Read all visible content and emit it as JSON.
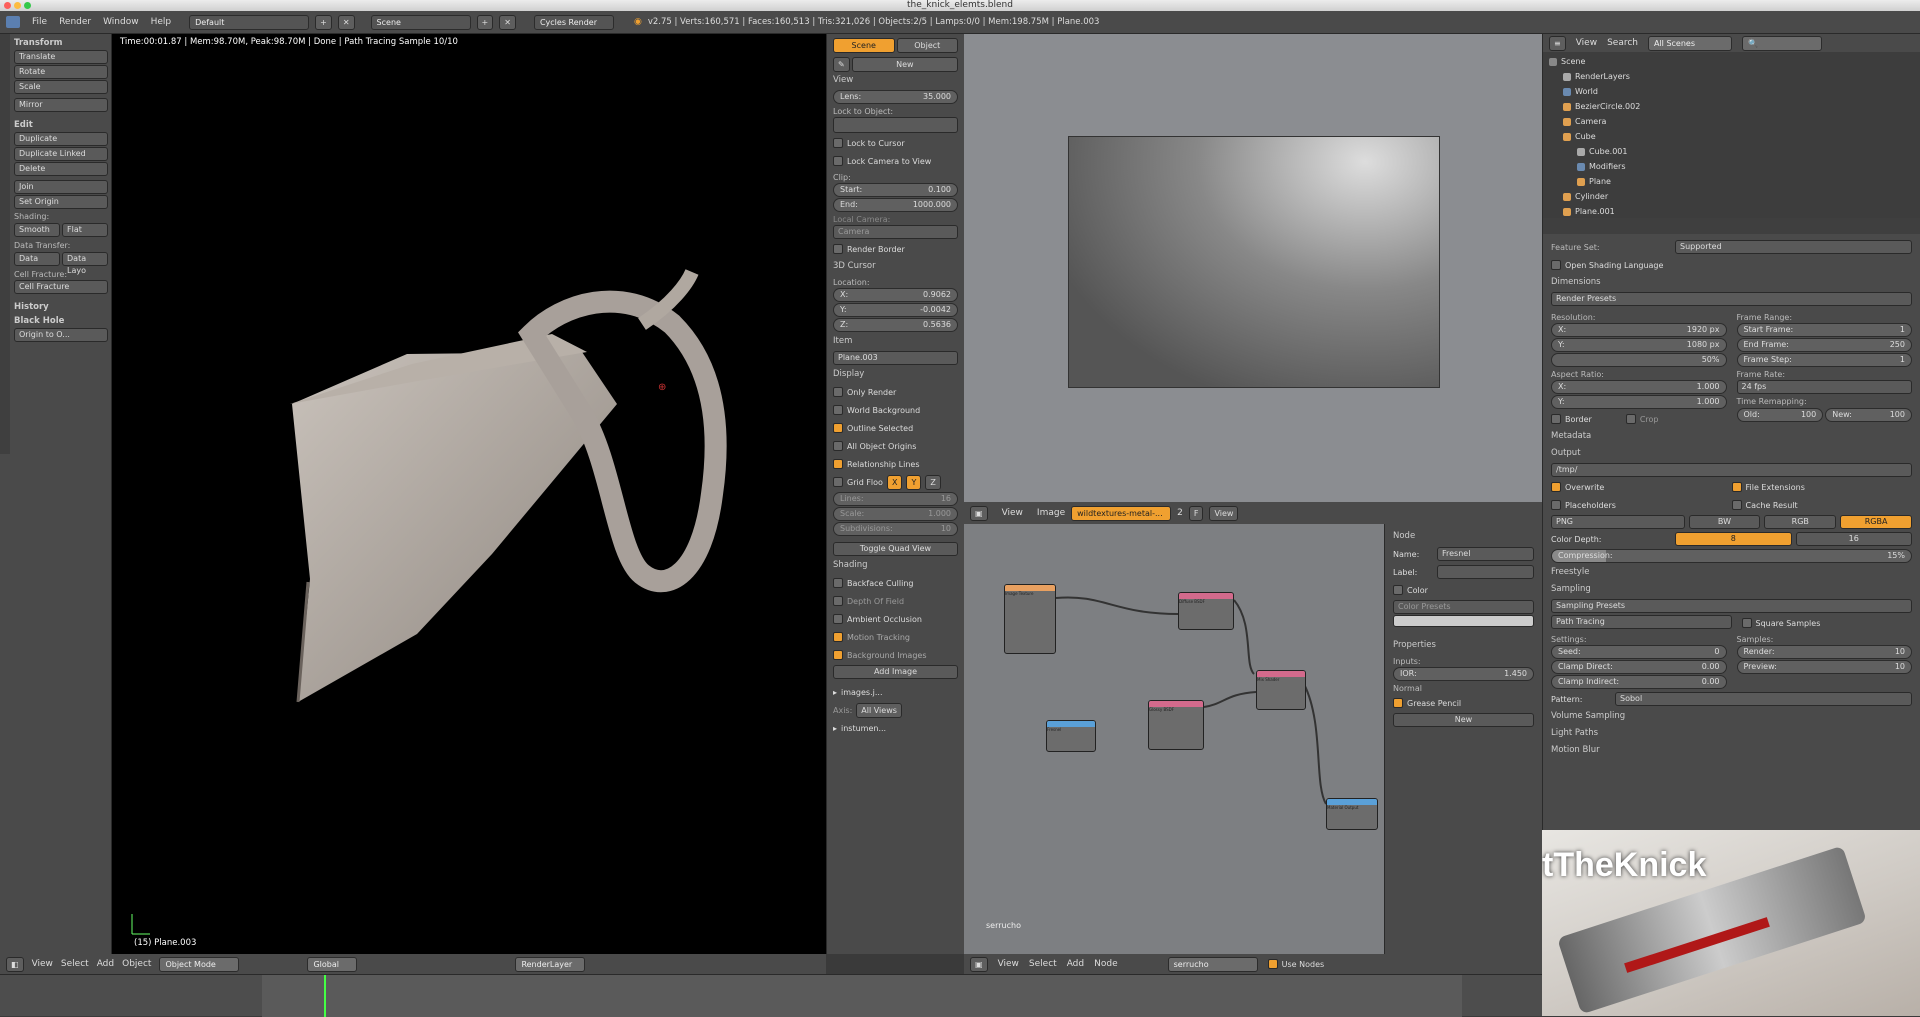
{
  "window": {
    "title": "the_knick_elemts.blend"
  },
  "topbar": {
    "menus": [
      "File",
      "Render",
      "Window",
      "Help"
    ],
    "layout": "Default",
    "scene": "Scene",
    "engine": "Cycles Render",
    "stats": "v2.75 | Verts:160,571 | Faces:160,513 | Tris:321,026 | Objects:2/5 | Lamps:0/0 | Mem:198.75M | Plane.003"
  },
  "toolshelf": {
    "transform_header": "Transform",
    "translate": "Translate",
    "rotate": "Rotate",
    "scale": "Scale",
    "mirror": "Mirror",
    "edit_header": "Edit",
    "duplicate": "Duplicate",
    "duplicate_linked": "Duplicate Linked",
    "delete": "Delete",
    "join": "Join",
    "set_origin": "Set Origin",
    "shading_label": "Shading:",
    "smooth": "Smooth",
    "flat": "Flat",
    "data_transfer_label": "Data Transfer:",
    "data": "Data",
    "data_layo": "Data Layo",
    "cell_fracture_label": "Cell Fracture:",
    "cell_fracture": "Cell Fracture",
    "history": "History",
    "black_hole": "Black Hole",
    "origin_to": "Origin to O..."
  },
  "viewport": {
    "info": "Time:00:01.87 | Mem:98.70M, Peak:98.70M | Done | Path Tracing Sample 10/10",
    "object_label": "(15) Plane.003"
  },
  "props": {
    "tab_scene": "Scene",
    "tab_object": "Object",
    "new": "New",
    "view_header": "View",
    "lens_label": "Lens:",
    "lens_value": "35.000",
    "lock_to_object": "Lock to Object:",
    "lock_to_cursor": "Lock to Cursor",
    "lock_camera": "Lock Camera to View",
    "clip_label": "Clip:",
    "start_label": "Start:",
    "start_value": "0.100",
    "end_label": "End:",
    "end_value": "1000.000",
    "local_camera": "Local Camera:",
    "camera": "Camera",
    "render_border": "Render Border",
    "cursor_header": "3D Cursor",
    "location": "Location:",
    "x_label": "X:",
    "x_value": "0.9062",
    "y_label": "Y:",
    "y_value": "-0.0042",
    "z_label": "Z:",
    "z_value": "0.5636",
    "item_header": "Item",
    "item_name": "Plane.003",
    "display_header": "Display",
    "only_render": "Only Render",
    "world_bg": "World Background",
    "outline_sel": "Outline Selected",
    "all_origins": "All Object Origins",
    "rel_lines": "Relationship Lines",
    "grid_floor": "Grid Floo",
    "gx": "X",
    "gy": "Y",
    "gz": "Z",
    "lines_label": "Lines:",
    "lines_value": "16",
    "scale_label": "Scale:",
    "scale_value": "1.000",
    "subdiv_label": "Subdivisions:",
    "subdiv_value": "10",
    "toggle_quad": "Toggle Quad View",
    "shading_header": "Shading",
    "backface": "Backface Culling",
    "dof": "Depth Of Field",
    "ao": "Ambient Occlusion",
    "motion_tracking": "Motion Tracking",
    "bg_images": "Background Images",
    "add_image": "Add Image",
    "img1": "images.j...",
    "axis_label": "Axis:",
    "all_views": "All Views",
    "img2": "instumen..."
  },
  "image_editor": {
    "menus": [
      "View",
      "Image"
    ],
    "image_name": "wildtextures-metal-...",
    "users": "2",
    "f": "F",
    "view": "View"
  },
  "node_editor": {
    "label": "serrucho",
    "header_menus": [
      "View",
      "Select",
      "Add",
      "Node"
    ],
    "material": "serrucho",
    "use_nodes": "Use Nodes",
    "nodes": {
      "image_texture": "Image Texture",
      "diffuse": "Diffuse BSDF",
      "glossy": "Glossy BSDF",
      "mix": "Mix Shader",
      "fresnel": "Fresnel",
      "output": "Material Output"
    }
  },
  "node_sidebar": {
    "node_header": "Node",
    "name_label": "Name:",
    "name_value": "Fresnel",
    "label_label": "Label:",
    "color_header": "Color",
    "color_presets": "Color Presets",
    "properties_header": "Properties",
    "inputs": "Inputs:",
    "ior_label": "IOR:",
    "ior_value": "1.450",
    "normal": "Normal",
    "grease_pencil": "Grease Pencil",
    "new": "New"
  },
  "outliner": {
    "menus": [
      "View",
      "Search"
    ],
    "filter": "All Scenes",
    "items": [
      "Scene",
      "RenderLayers",
      "World",
      "BezierCircle.002",
      "Camera",
      "Cube",
      "Cube.001",
      "Modifiers",
      "Plane",
      "Cylinder",
      "Plane.001"
    ]
  },
  "render_props": {
    "feature_set_label": "Feature Set:",
    "feature_set": "Supported",
    "osl": "Open Shading Language",
    "dimensions": "Dimensions",
    "render_presets": "Render Presets",
    "resolution": "Resolution:",
    "res_x_label": "X:",
    "res_x": "1920 px",
    "res_y_label": "Y:",
    "res_y": "1080 px",
    "res_pct": "50%",
    "frame_range": "Frame Range:",
    "start_frame_label": "Start Frame:",
    "start_frame": "1",
    "end_frame_label": "End Frame:",
    "end_frame": "250",
    "frame_step_label": "Frame Step:",
    "frame_step": "1",
    "aspect": "Aspect Ratio:",
    "asp_x_label": "X:",
    "asp_x": "1.000",
    "asp_y_label": "Y:",
    "asp_y": "1.000",
    "frame_rate": "Frame Rate:",
    "fps": "24 fps",
    "time_remap": "Time Remapping:",
    "old_label": "Old:",
    "old": "100",
    "new_label": "New:",
    "new": "100",
    "border": "Border",
    "crop": "Crop",
    "metadata": "Metadata",
    "output": "Output",
    "path": "/tmp/",
    "overwrite": "Overwrite",
    "file_ext": "File Extensions",
    "placeholders": "Placeholders",
    "cache_result": "Cache Result",
    "format": "PNG",
    "bw": "BW",
    "rgb": "RGB",
    "rgba": "RGBA",
    "color_depth": "Color Depth:",
    "depth8": "8",
    "depth16": "16",
    "compression_label": "Compression:",
    "compression": "15%",
    "freestyle": "Freestyle",
    "sampling": "Sampling",
    "sampling_presets": "Sampling Presets",
    "path_tracing": "Path Tracing",
    "square_samples": "Square Samples",
    "settings": "Settings:",
    "samples": "Samples:",
    "seed_label": "Seed:",
    "seed": "0",
    "render_label": "Render:",
    "render": "10",
    "clamp_direct_label": "Clamp Direct:",
    "clamp_direct": "0.00",
    "preview_label": "Preview:",
    "preview": "10",
    "clamp_indirect_label": "Clamp Indirect:",
    "clamp_indirect": "0.00",
    "pattern_label": "Pattern:",
    "pattern": "Sobol",
    "volume_sampling": "Volume Sampling",
    "light_paths": "Light Paths",
    "motion_blur": "Motion Blur"
  },
  "poster": {
    "text": "tTheKnick"
  },
  "bottombar": {
    "menus": [
      "View",
      "Select",
      "Add",
      "Object"
    ],
    "mode": "Object Mode",
    "orientation": "Global",
    "render_layer": "RenderLayer"
  }
}
